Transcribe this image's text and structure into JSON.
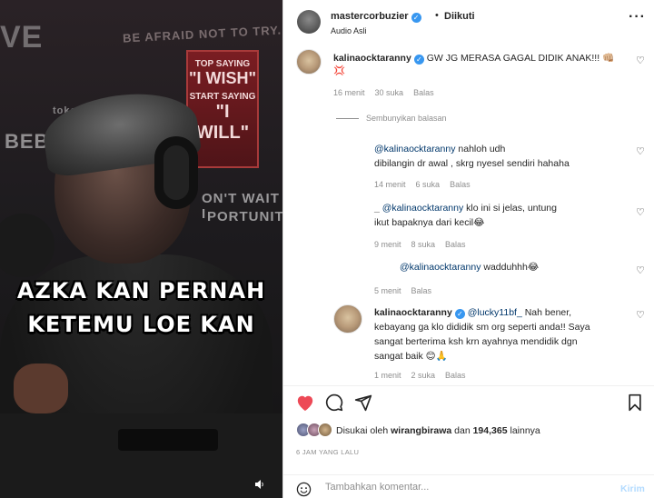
{
  "video": {
    "caption_line1": "AZKA KAN PERNAH",
    "caption_line2": "KETEMU LOE KAN",
    "bg_sign_top": "BE AFRAID NOT TO TRY.",
    "bg_sign_left": "BEBAS O",
    "bg_sign_tokopedia": "tokopedia",
    "bg_sign_right1": "ON'T WAIT I",
    "bg_sign_right2": "PORTUNIT",
    "bg_sign_ve": "VE",
    "panel_line1": "TOP SAYING",
    "panel_line2": "\"I WISH\"",
    "panel_line3": "START SAYING",
    "panel_line4": "\"I WILL\"",
    "sound_icon": "speaker-icon"
  },
  "header": {
    "username": "mastercorbuzier",
    "separator": "•",
    "follow_status": "Diikuti",
    "audio": "Audio Asli",
    "more": "···"
  },
  "comments": [
    {
      "user": "kalinaocktaranny",
      "text": "GW JG MERASA GAGAL DIDIK ANAK!!! 👊🏼",
      "text2": "💢",
      "time": "16 menit",
      "likes": "30 suka",
      "reply": "Balas"
    },
    {
      "hide_label": "Sembunyikan balasan"
    },
    {
      "user": "",
      "mention": "@kalinaocktaranny",
      "text": " nahloh udh",
      "text2": "dibilangin dr awal , skrg nyesel sendiri hahaha",
      "time": "14 menit",
      "likes": "6 suka",
      "reply": "Balas"
    },
    {
      "user": "_",
      "mention": "@kalinaocktaranny",
      "text": " klo ini si jelas, untung",
      "text2": "ikut bapaknya dari kecil😂",
      "time": "9 menit",
      "likes": "8 suka",
      "reply": "Balas"
    },
    {
      "user": "",
      "mention": "@kalinaocktaranny",
      "text": " wadduhhh😂",
      "time": "5 menit",
      "reply": "Balas"
    },
    {
      "user": "kalinaocktaranny",
      "mention": "@lucky11bf_",
      "text": " Nah bener,",
      "text2": "kebayang ga klo dididik sm org seperti anda!! Saya",
      "text3": "sangat berterima ksh krn ayahnya mendidik dgn",
      "text4": "sangat baik 😊🙏",
      "time": "1 menit",
      "likes": "2 suka",
      "reply": "Balas"
    }
  ],
  "actions": {
    "like_icon": "heart-icon",
    "comment_icon": "comment-icon",
    "share_icon": "send-icon",
    "save_icon": "bookmark-icon",
    "liked_color": "#ed4956"
  },
  "likes": {
    "prefix": "Disukai oleh ",
    "user": "wirangbirawa",
    "middle": " dan ",
    "count": "194,365",
    "suffix": " lainnya"
  },
  "time_ago": "6 JAM YANG LALU",
  "add_comment": {
    "placeholder": "Tambahkan komentar...",
    "post_label": "Kirim"
  }
}
